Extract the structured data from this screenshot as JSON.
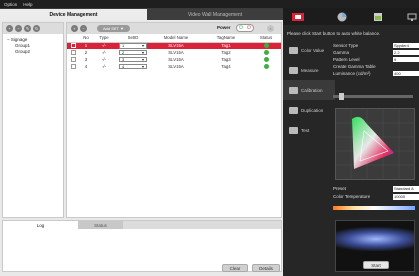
{
  "menu": {
    "items": [
      "Option",
      "Help"
    ]
  },
  "tabs": {
    "active": "Device Management",
    "inactive": "Video Wall Management"
  },
  "tree": {
    "root": "Signage",
    "children": [
      "Group1",
      "Group2"
    ]
  },
  "toolbar": {
    "add_set_label": "Add SET ▼",
    "power_label": "Power"
  },
  "table": {
    "headers": [
      "No",
      "Type",
      "SetID",
      "Model Name",
      "TagName",
      "Status"
    ],
    "rows": [
      {
        "no": "1",
        "type": "-/-",
        "setid": "1",
        "model": "SLV15A",
        "tag": "Tag1",
        "selected": true
      },
      {
        "no": "2",
        "type": "-/-",
        "setid": "2",
        "model": "SLV15A",
        "tag": "Tag2",
        "selected": false
      },
      {
        "no": "3",
        "type": "-/-",
        "setid": "3",
        "model": "SLV15A",
        "tag": "Tag3",
        "selected": false
      },
      {
        "no": "4",
        "type": "-/-",
        "setid": "4",
        "model": "SLV15A",
        "tag": "Tag4",
        "selected": false
      }
    ]
  },
  "log": {
    "tab_log": "Log",
    "tab_status": "Status",
    "clear_label": "Clear",
    "details_label": "Details"
  },
  "right": {
    "message": "Please click Start button to auto white balance.",
    "nav": [
      {
        "label": "Color Value",
        "icon": "eyedropper-icon"
      },
      {
        "label": "Measure",
        "icon": "image-icon"
      },
      {
        "label": "Calibration",
        "icon": "calibration-icon"
      },
      {
        "label": "Duplication",
        "icon": "duplicate-icon"
      },
      {
        "label": "Test",
        "icon": "test-icon"
      }
    ],
    "fields": [
      {
        "label": "Sensor Type",
        "value": "Spyder4"
      },
      {
        "label": "Gamma",
        "value": "2.2"
      },
      {
        "label": "Pattern Level",
        "value": "9"
      },
      {
        "label": "Create Gamma Table",
        "value": ""
      },
      {
        "label": "Luminance (cd/m²)",
        "value": "400"
      }
    ],
    "preset_label": "Preset",
    "preset_value": "Standard A",
    "colortemp_label": "Color Temperature",
    "colortemp_value": "10000",
    "start_label": "Start"
  },
  "colors": {
    "selected_row": "#d9233b",
    "status_ok": "#3fae3f",
    "accent_red": "#e0213a"
  }
}
